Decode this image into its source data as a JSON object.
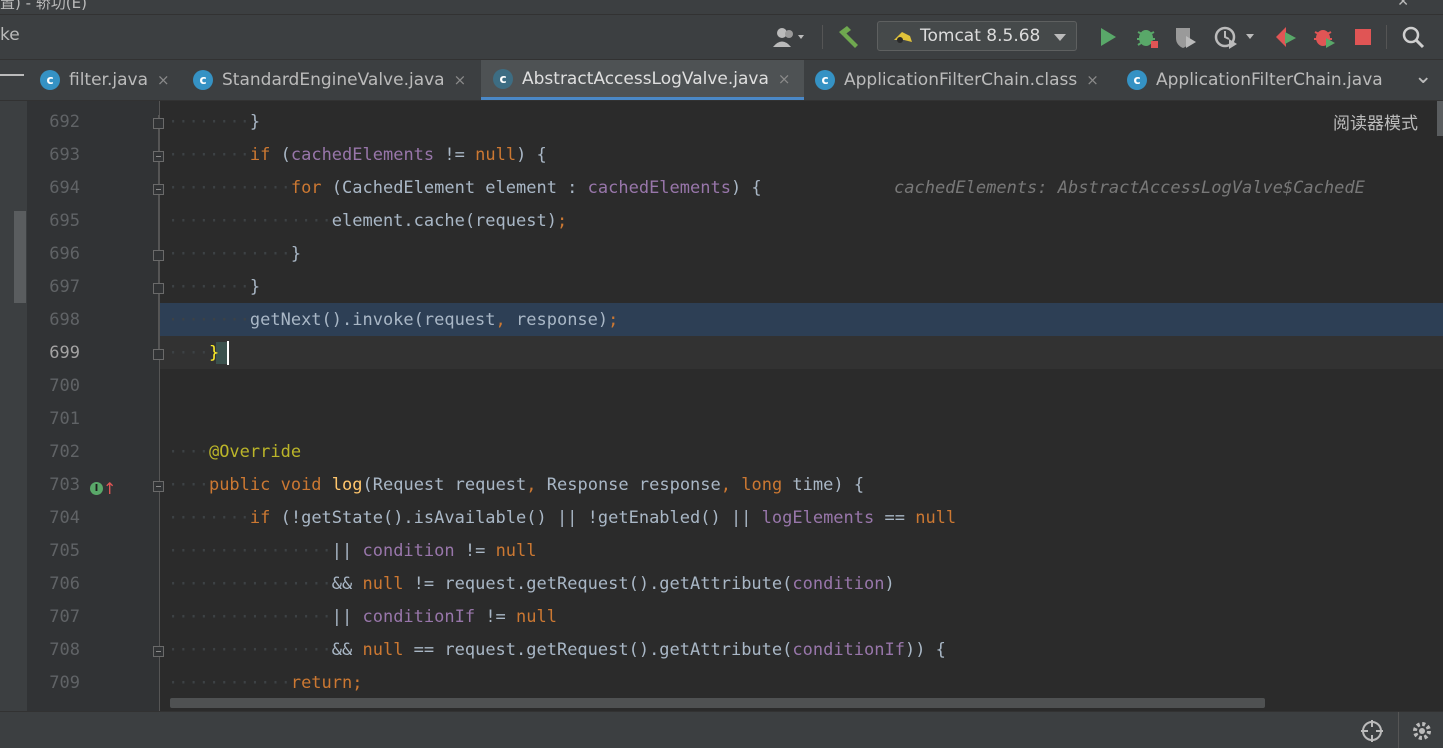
{
  "window": {
    "title_fragment": "置) - 轿功(E)",
    "close_glyph": "✕"
  },
  "toolbar": {
    "left_text": "ke",
    "run_config": "Tomcat 8.5.68",
    "icons": [
      "user-icon",
      "hammer-icon",
      "tomcat-icon",
      "run-icon",
      "debug-icon",
      "coverage-icon",
      "profiler-icon",
      "stop-icon",
      "search-icon"
    ]
  },
  "tabs": [
    {
      "label": "filter.java",
      "close": "×",
      "active": false
    },
    {
      "label": "StandardEngineValve.java",
      "close": "×",
      "active": false
    },
    {
      "label": "AbstractAccessLogValve.java",
      "close": "×",
      "active": true
    },
    {
      "label": "ApplicationFilterChain.class",
      "close": "×",
      "active": false
    },
    {
      "label": "ApplicationFilterChain.java",
      "close": "",
      "active": false
    }
  ],
  "tab_overflow": "⌄",
  "editor": {
    "reader_mode": "阅读器模式",
    "inlay_hint": "cachedElements: AbstractAccessLogValve$CachedE",
    "line_numbers": [
      "692",
      "693",
      "694",
      "695",
      "696",
      "697",
      "698",
      "699",
      "700",
      "701",
      "702",
      "703",
      "704",
      "705",
      "706",
      "707",
      "708",
      "709"
    ],
    "current_line": "699",
    "execution_line": "698",
    "override_marker_line": "703"
  },
  "colors": {
    "background": "#2b2b2b",
    "keyword": "#cc7832",
    "field": "#9876aa",
    "annotation": "#bbb529",
    "method_decl": "#ffc66d",
    "text": "#a9b7c6",
    "execution_highlight": "#2d3f55",
    "active_tab_underline": "#4a88c7"
  }
}
